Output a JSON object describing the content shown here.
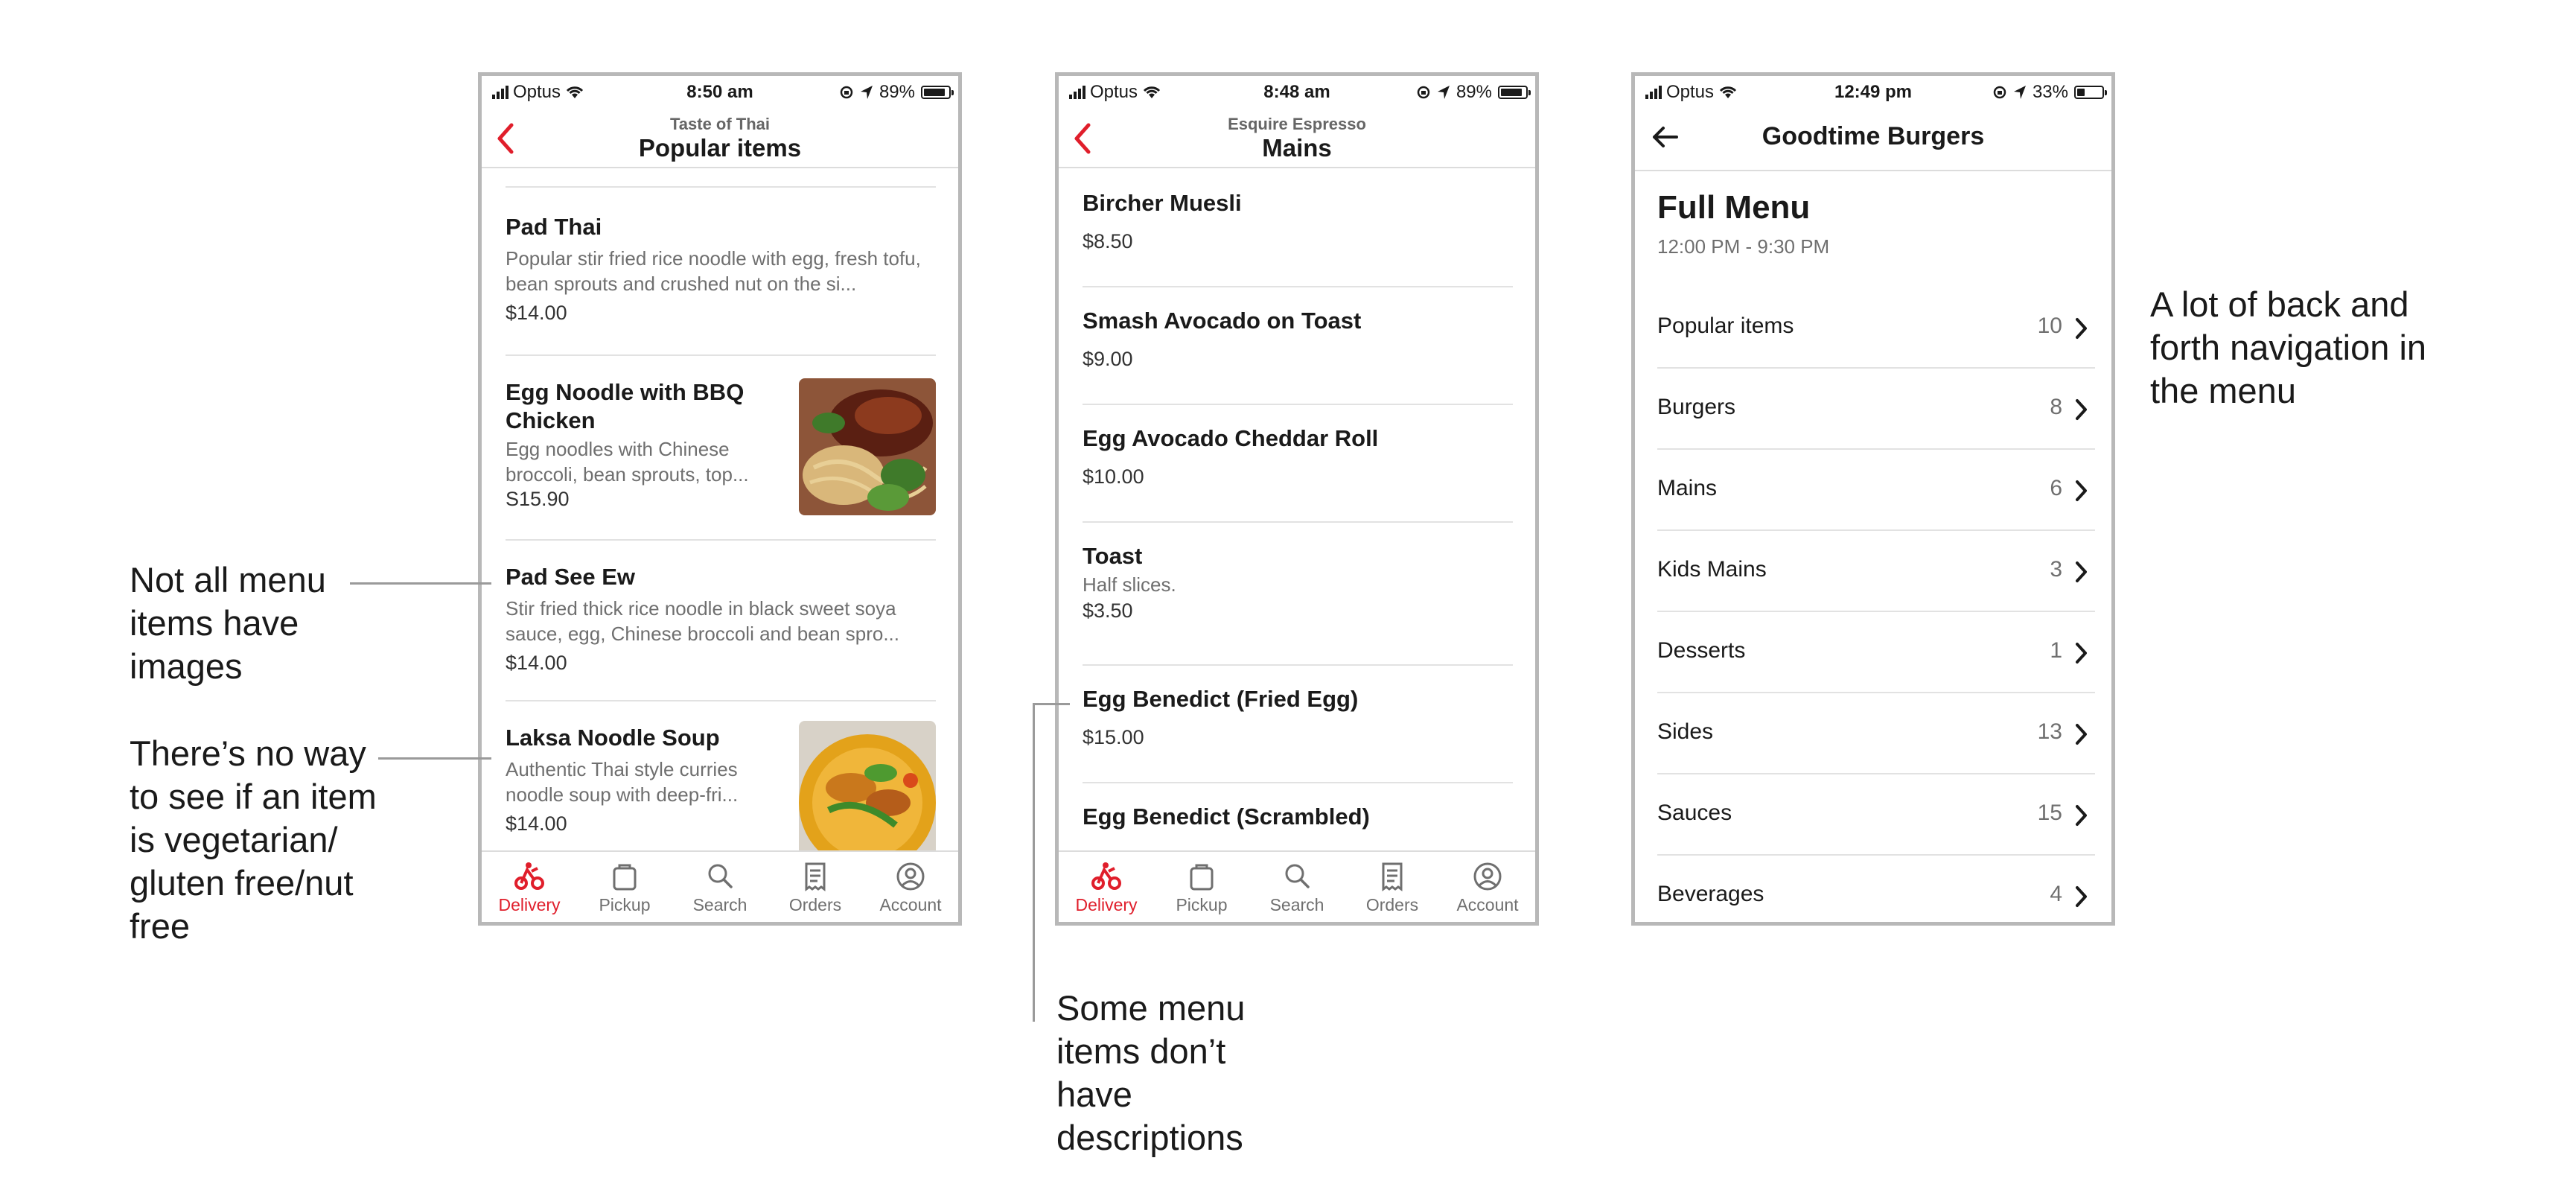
{
  "colors": {
    "accent": "#e01e2b",
    "border": "#b8b8b8",
    "muted": "#6f6f6f"
  },
  "phone1": {
    "status": {
      "carrier": "Optus",
      "time": "8:50 am",
      "battery": "89%",
      "battery_level": 0.89
    },
    "nav": {
      "subtitle": "Taste of Thai",
      "title": "Popular items"
    },
    "items": [
      {
        "name": "Pad Thai",
        "desc": "Popular stir fried rice noodle with egg, fresh tofu, bean sprouts and crushed nut on the si...",
        "price": "$14.00"
      },
      {
        "name": "Egg Noodle with BBQ Chicken",
        "desc": "Egg noodles with Chinese broccoli, bean sprouts, top...",
        "price": "S15.90"
      },
      {
        "name": "Pad See Ew",
        "desc": "Stir fried thick rice noodle in black sweet soya sauce, egg, Chinese broccoli and bean spro...",
        "price": "$14.00"
      },
      {
        "name": "Laksa Noodle Soup",
        "desc": "Authentic Thai style curries noodle soup with deep-fri...",
        "price": "$14.00"
      }
    ]
  },
  "phone2": {
    "status": {
      "carrier": "Optus",
      "time": "8:48 am",
      "battery": "89%",
      "battery_level": 0.89
    },
    "nav": {
      "subtitle": "Esquire Espresso",
      "title": "Mains"
    },
    "items": [
      {
        "name": "Bircher Muesli",
        "price": "$8.50"
      },
      {
        "name": "Smash Avocado on Toast",
        "price": "$9.00"
      },
      {
        "name": "Egg Avocado Cheddar Roll",
        "price": "$10.00"
      },
      {
        "name": "Toast",
        "desc": "Half slices.",
        "price": "$3.50"
      },
      {
        "name": "Egg Benedict (Fried Egg)",
        "price": "$15.00"
      },
      {
        "name": "Egg Benedict (Scrambled)"
      }
    ]
  },
  "phone3": {
    "status": {
      "carrier": "Optus",
      "time": "12:49 pm",
      "battery": "33%",
      "battery_level": 0.33
    },
    "nav": {
      "title": "Goodtime Burgers"
    },
    "menu_title": "Full Menu",
    "hours": "12:00 PM - 9:30 PM",
    "categories": [
      {
        "name": "Popular items",
        "count": "10"
      },
      {
        "name": "Burgers",
        "count": "8"
      },
      {
        "name": "Mains",
        "count": "6"
      },
      {
        "name": "Kids Mains",
        "count": "3"
      },
      {
        "name": "Desserts",
        "count": "1"
      },
      {
        "name": "Sides",
        "count": "13"
      },
      {
        "name": "Sauces",
        "count": "15"
      },
      {
        "name": "Beverages",
        "count": "4"
      }
    ]
  },
  "tabs": [
    {
      "label": "Delivery",
      "icon": "delivery-icon",
      "active": true
    },
    {
      "label": "Pickup",
      "icon": "bag-icon"
    },
    {
      "label": "Search",
      "icon": "search-icon"
    },
    {
      "label": "Orders",
      "icon": "receipt-icon"
    },
    {
      "label": "Account",
      "icon": "account-icon"
    }
  ],
  "annotations": {
    "images": "Not all menu items have images",
    "dietary": "There’s no way to see if an item is vegetarian/ gluten free/nut free",
    "descriptions": "Some menu items don’t have descriptions",
    "navigation": "A lot of back and forth navigation in the menu"
  }
}
